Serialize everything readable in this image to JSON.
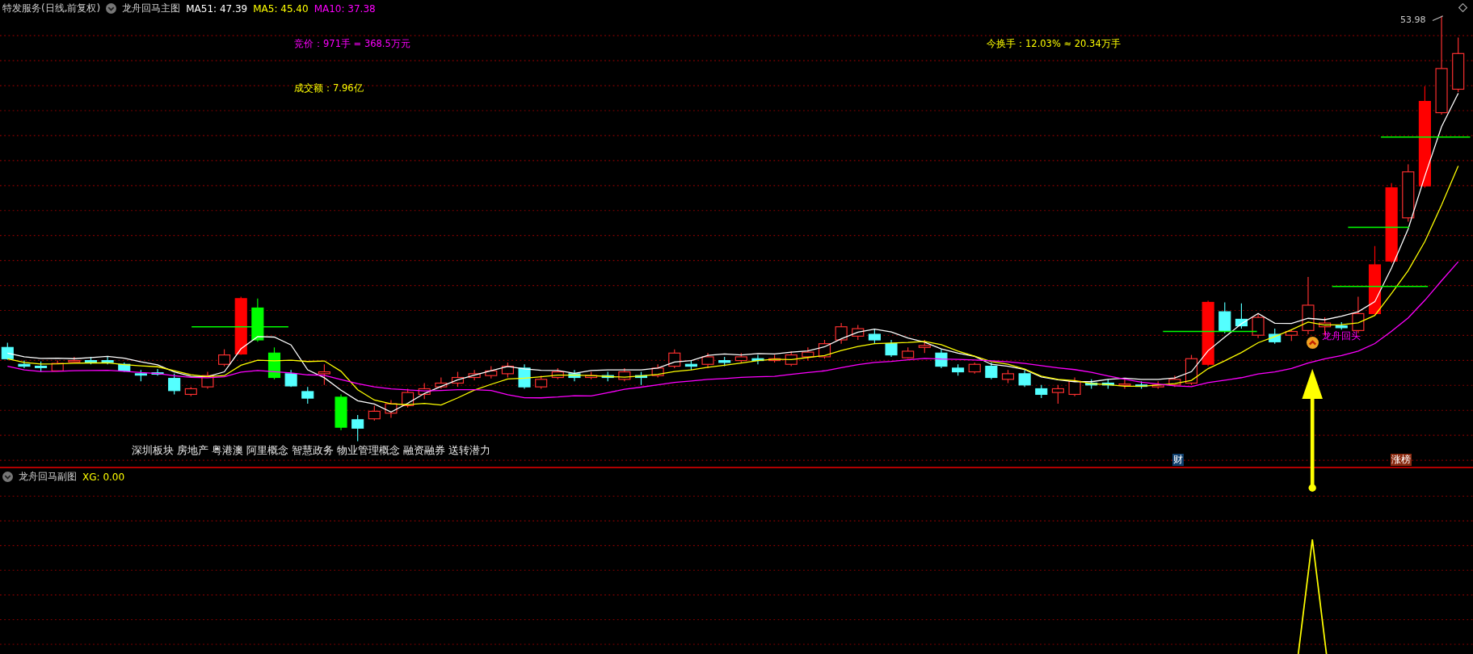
{
  "main_panel": {
    "title": "特发服务(日线,前复权)",
    "indicator_name": "龙舟回马主图",
    "indicators": [
      {
        "label": "MA51: 47.39",
        "color": "#ffffff"
      },
      {
        "label": "MA5: 45.40",
        "color": "#ffff00"
      },
      {
        "label": "MA10: 37.38",
        "color": "#ff00ff"
      }
    ],
    "overlays": [
      {
        "text": "竞价：971手 = 368.5万元",
        "color": "#ff00ff"
      },
      {
        "text": "今换手：12.03% ≈ 20.34万手",
        "color": "#ffff00"
      },
      {
        "text": "成交额：7.96亿",
        "color": "#ffff00"
      }
    ],
    "high_label": "53.98",
    "signal_label": "龙舟回头",
    "concepts": "深圳板块 房地产 粤港澳 阿里概念 智慧政务 物业管理概念 融资融券 送转潜力",
    "tags": [
      {
        "text": "财",
        "color": "#0e3f6e"
      },
      {
        "text": "涨榜",
        "color": "#8b2a10"
      }
    ]
  },
  "sub_panel": {
    "title": "龙舟回马副图",
    "indicators": [
      {
        "label": "XG: 0.00",
        "color": "#ffff00"
      }
    ]
  }
}
